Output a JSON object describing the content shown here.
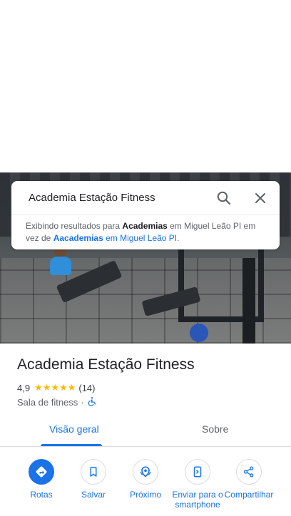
{
  "search": {
    "query": "Academia Estação Fitness",
    "note_prefix": "Exibindo resultados para ",
    "note_term": "Academias",
    "note_mid": " em Miguel Leão PI em vez de ",
    "note_link_term": "Aacademias",
    "note_link_rest": " em Miguel Leão PI",
    "note_end": "."
  },
  "place": {
    "name": "Academia Estação Fitness",
    "rating": "4,9",
    "stars": "★★★★★",
    "reviews": "(14)",
    "category": "Sala de fitness",
    "separator": "·",
    "accessible_icon": "wheelchair-icon"
  },
  "tabs": [
    {
      "label": "Visão geral",
      "active": true
    },
    {
      "label": "Sobre",
      "active": false
    }
  ],
  "actions": [
    {
      "label": "Rotas",
      "icon": "directions-icon"
    },
    {
      "label": "Salvar",
      "icon": "bookmark-icon"
    },
    {
      "label": "Próximo",
      "icon": "nearby-icon"
    },
    {
      "label": "Enviar para o smartphone",
      "icon": "send-to-phone-icon"
    },
    {
      "label": "Compartilhar",
      "icon": "share-icon"
    }
  ],
  "colors": {
    "accent": "#1a73e8",
    "star": "#fbbc04",
    "text": "#202124",
    "muted": "#5f6368"
  }
}
